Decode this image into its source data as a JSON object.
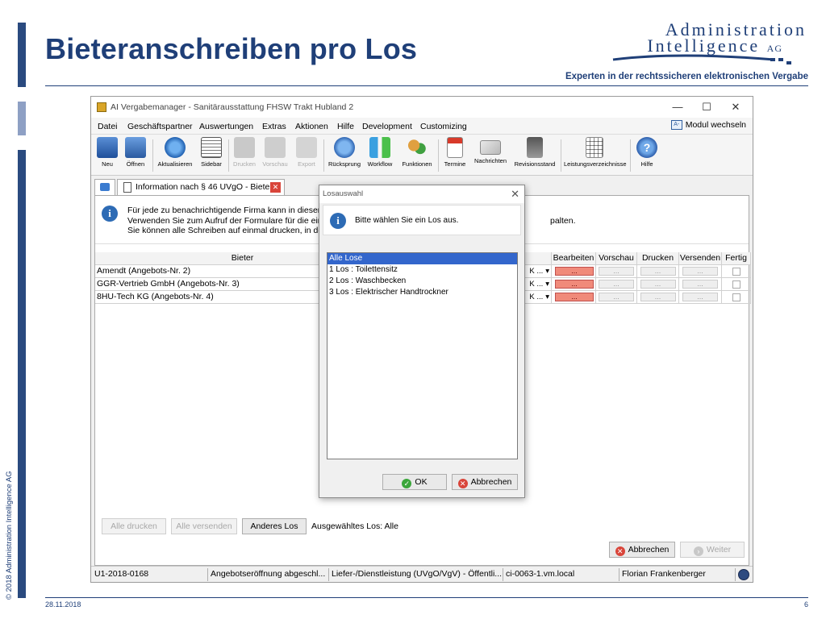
{
  "slide": {
    "title": "Bieteranschreiben pro Los",
    "logo_line1": "Administration",
    "logo_line2": "Intelligence",
    "logo_ag": "AG",
    "subtitle": "Experten in der rechtssicheren elektronischen Vergabe",
    "copyright": "© 2018 Administration Intelligence AG",
    "date": "28.11.2018",
    "page": "6",
    "accent_color": "#1f3f78"
  },
  "window": {
    "title": "AI Vergabemanager - Sanitärausstattung FHSW Trakt Hubland 2",
    "controls": [
      "—",
      "☐",
      "✕"
    ]
  },
  "menu": {
    "items": [
      "Datei",
      "Geschäftspartner",
      "Auswertungen",
      "Extras",
      "Aktionen",
      "Hilfe",
      "Development",
      "Customizing"
    ],
    "modul_wechseln": "Modul wechseln"
  },
  "toolbar": {
    "buttons": [
      {
        "label": "Neu",
        "icon": "new-icon"
      },
      {
        "label": "Öffnen",
        "icon": "open-icon"
      },
      {
        "label": "Aktualisieren",
        "icon": "refresh-icon"
      },
      {
        "label": "Sidebar",
        "icon": "sidebar-icon"
      },
      {
        "label": "Drucken",
        "icon": "print-icon"
      },
      {
        "label": "Vorschau",
        "icon": "preview-icon"
      },
      {
        "label": "Export",
        "icon": "export-icon"
      },
      {
        "label": "Rücksprung",
        "icon": "back-icon"
      },
      {
        "label": "Workflow",
        "icon": "workflow-icon"
      },
      {
        "label": "Funktionen",
        "icon": "functions-icon"
      },
      {
        "label": "Termine",
        "icon": "calendar-icon"
      },
      {
        "label": "Nachrichten",
        "icon": "mail-icon"
      },
      {
        "label": "Revisionsstand",
        "icon": "revision-icon"
      },
      {
        "label": "Leistungsverzeichnisse",
        "icon": "table-icon"
      },
      {
        "label": "Hilfe",
        "icon": "help-icon"
      }
    ]
  },
  "tab": {
    "label": "Information nach § 46 UVgO - Bieter"
  },
  "info": {
    "line1": "Für jede zu benachrichtigende Firma kann in diesem D",
    "line2": "Verwenden Sie zum Aufruf der Formulare für die einze",
    "line3": "Sie können alle Schreiben auf einmal drucken, in dem",
    "line2_tail": "palten."
  },
  "grid": {
    "headers": {
      "bieter": "Bieter",
      "bearbeiten": "Bearbeiten",
      "vorschau": "Vorschau",
      "drucken": "Drucken",
      "versenden": "Versenden",
      "fertig": "Fertig"
    },
    "rows": [
      {
        "bieter": "Amendt (Angebots-Nr. 2)",
        "select": "K ...",
        "edit": "...",
        "dots": "..."
      },
      {
        "bieter": "GGR-Vertrieb GmbH (Angebots-Nr. 3)",
        "select": "K ...",
        "edit": "...",
        "dots": "..."
      },
      {
        "bieter": "8HU-Tech KG (Angebots-Nr. 4)",
        "select": "K ...",
        "edit": "...",
        "dots": "..."
      }
    ]
  },
  "bottom": {
    "alle_drucken": "Alle drucken",
    "alle_versenden": "Alle versenden",
    "anderes_los": "Anderes Los",
    "ausgewaehlt": "Ausgewähltes Los: Alle",
    "abbrechen": "Abbrechen",
    "weiter": "Weiter"
  },
  "statusbar": {
    "id": "U1-2018-0168",
    "phase": "Angebotseröffnung abgeschl...",
    "type": "Liefer-/Dienstleistung (UVgO/VgV) - Öffentli...",
    "host": "ci-0063-1.vm.local",
    "user": "Florian Frankenberger"
  },
  "dialog": {
    "title": "Losauswahl",
    "message": "Bitte wählen Sie ein Los aus.",
    "items": [
      "Alle Lose",
      "1 Los : Toilettensitz",
      "2 Los : Waschbecken",
      "3 Los : Elektrischer Handtrockner"
    ],
    "selected_index": 0,
    "ok": "OK",
    "cancel": "Abbrechen"
  }
}
